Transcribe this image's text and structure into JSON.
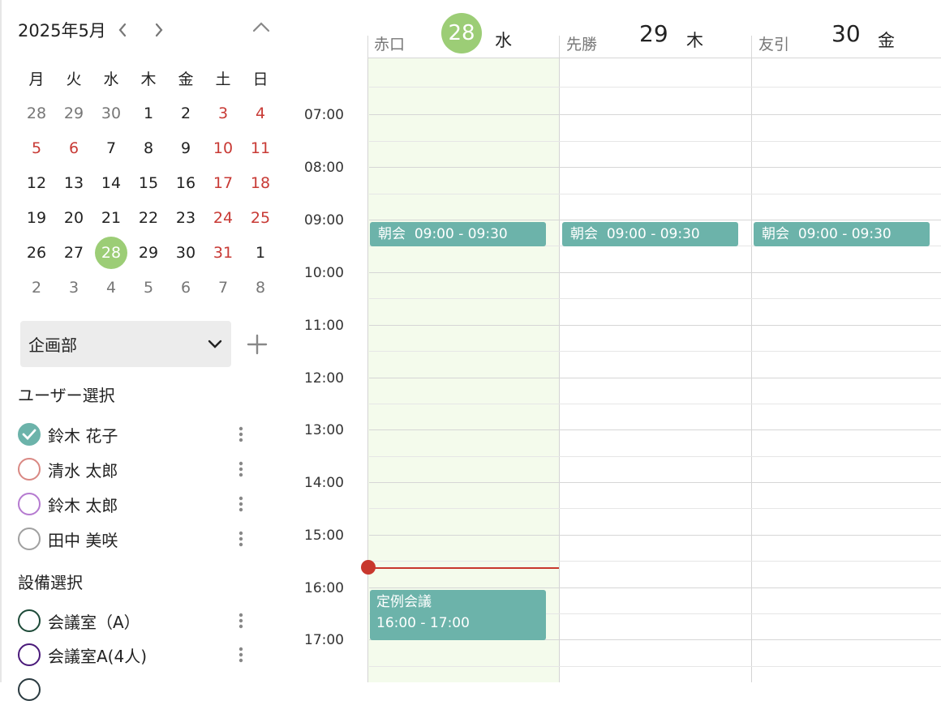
{
  "mini_calendar": {
    "title": "2025年5月",
    "weekdays": [
      "月",
      "火",
      "水",
      "木",
      "金",
      "土",
      "日"
    ],
    "weeks": [
      [
        "28",
        "29",
        "30",
        "1",
        "2",
        "3",
        "4"
      ],
      [
        "5",
        "6",
        "7",
        "8",
        "9",
        "10",
        "11"
      ],
      [
        "12",
        "13",
        "14",
        "15",
        "16",
        "17",
        "18"
      ],
      [
        "19",
        "20",
        "21",
        "22",
        "23",
        "24",
        "25"
      ],
      [
        "26",
        "27",
        "28",
        "29",
        "30",
        "31",
        "1"
      ],
      [
        "2",
        "3",
        "4",
        "5",
        "6",
        "7",
        "8"
      ]
    ]
  },
  "department": {
    "selected": "企画部"
  },
  "user_section": {
    "title": "ユーザー選択",
    "users": [
      {
        "name": "鈴木 花子",
        "color": "#6cb3aa",
        "checked": true
      },
      {
        "name": "清水 太郎",
        "color": "#d98883",
        "checked": false
      },
      {
        "name": "鈴木 太郎",
        "color": "#b57ad0",
        "checked": false
      },
      {
        "name": "田中 美咲",
        "color": "#a0a0a0",
        "checked": false
      }
    ]
  },
  "equipment_section": {
    "title": "設備選択",
    "items": [
      {
        "name": "会議室（A）",
        "color": "#1d4a38"
      },
      {
        "name": "会議室A(4人)",
        "color": "#4a1a7a"
      },
      {
        "name": "",
        "color": "#2a3a40"
      }
    ]
  },
  "days": [
    {
      "rokuyo": "赤口",
      "date": "28",
      "weekday": "水",
      "today": true
    },
    {
      "rokuyo": "先勝",
      "date": "29",
      "weekday": "木",
      "today": false
    },
    {
      "rokuyo": "友引",
      "date": "30",
      "weekday": "金",
      "today": false
    }
  ],
  "time_labels": [
    "07:00",
    "08:00",
    "09:00",
    "10:00",
    "11:00",
    "12:00",
    "13:00",
    "14:00",
    "15:00",
    "16:00",
    "17:00"
  ],
  "events": [
    {
      "title": "朝会",
      "time": "09:00 - 09:30",
      "day": 0
    },
    {
      "title": "朝会",
      "time": "09:00 - 09:30",
      "day": 1
    },
    {
      "title": "朝会",
      "time": "09:00 - 09:30",
      "day": 2
    },
    {
      "title": "定例会議",
      "time": "16:00 - 17:00",
      "day": 0
    }
  ],
  "colors": {
    "accent": "#6cb3aa",
    "today": "#9ccd76",
    "holiday": "#c83a35",
    "now": "#c8372d"
  }
}
